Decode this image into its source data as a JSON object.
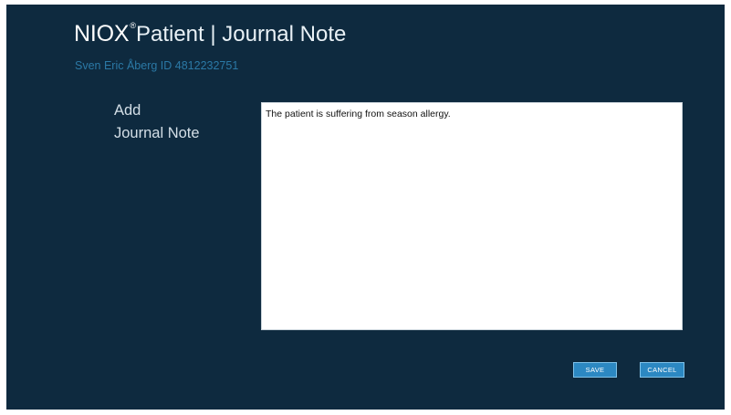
{
  "header": {
    "brand": "NIOX",
    "registered_mark": "®",
    "title_rest": "Patient | Journal Note"
  },
  "patient": {
    "line": "Sven Eric Åberg ID 4812232751"
  },
  "section": {
    "label_line1": "Add",
    "label_line2": "Journal Note"
  },
  "note": {
    "value": "The patient is suffering from season allergy."
  },
  "actions": {
    "save_label": "SAVE",
    "cancel_label": "CANCEL"
  },
  "colors": {
    "background": "#0e2a3f",
    "patient_text": "#2b79a6",
    "button": "#2c88c2"
  }
}
